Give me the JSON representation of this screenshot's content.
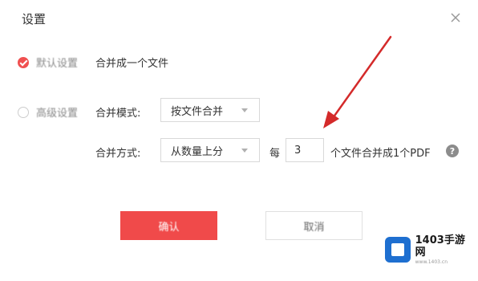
{
  "dialog": {
    "title": "设置",
    "close_icon": "close-icon"
  },
  "options": {
    "default": {
      "label": "默认设置",
      "checked": true,
      "description": "合并成一个文件"
    },
    "advanced": {
      "label": "高级设置",
      "checked": false
    }
  },
  "merge_mode": {
    "label": "合并模式:",
    "value": "按文件合并"
  },
  "merge_method": {
    "label": "合并方式:",
    "value": "从数量上分",
    "prefix": "每",
    "count": "3",
    "suffix": "个文件合并成1个PDF",
    "help_glyph": "?"
  },
  "buttons": {
    "confirm": "确认",
    "cancel": "取消"
  },
  "colors": {
    "accent": "#f04a4a",
    "annotation_arrow": "#d42a2a"
  },
  "watermark": {
    "name": "1403手游网",
    "sub": "www.1403.cn"
  }
}
